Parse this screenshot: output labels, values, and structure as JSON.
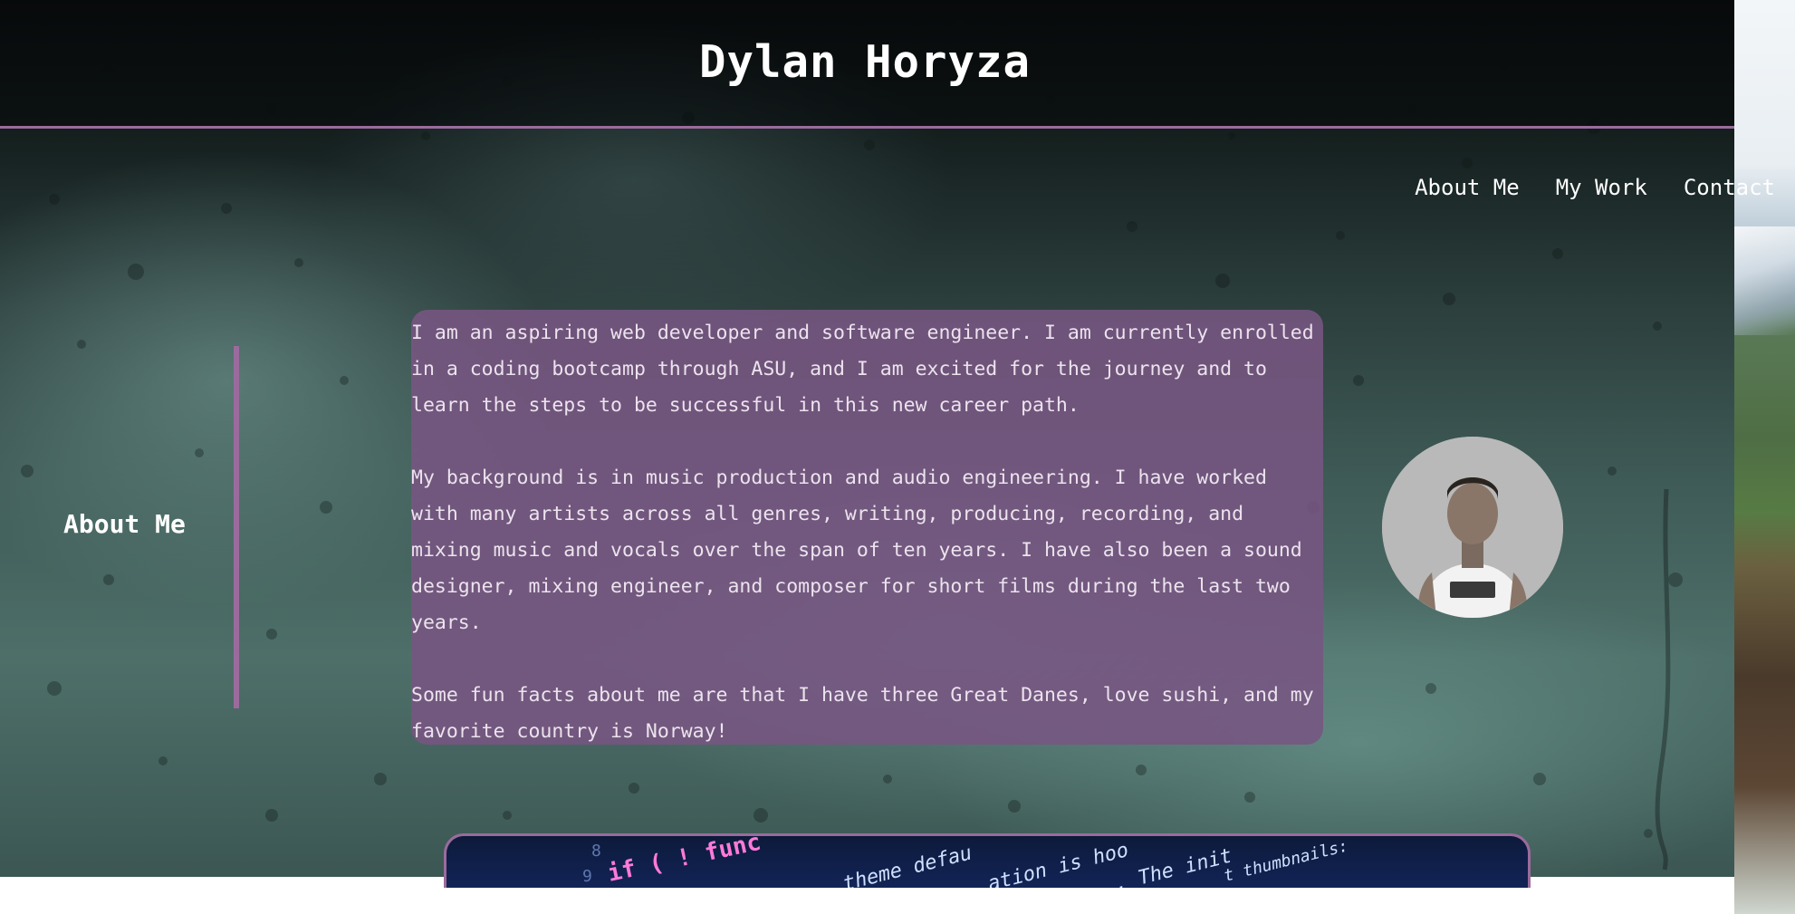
{
  "header": {
    "title": "Dylan Horyza"
  },
  "nav": {
    "items": [
      {
        "label": "About Me"
      },
      {
        "label": "My Work"
      },
      {
        "label": "Contact"
      }
    ]
  },
  "about": {
    "heading": "About Me",
    "paragraphs": [
      "I am an aspiring web developer and software engineer. I am currently enrolled in a coding bootcamp through ASU, and I am excited for the journey and to learn the steps to be successful in this new career path.",
      "My background is in music production and audio engineering. I have worked with many artists across all genres, writing, producing, recording, and mixing music and vocals over the span of ten years. I have also been a sound designer, mixing engineer, and composer for short films during the last two years.",
      "Some fun facts about me are that I have three Great Danes, love sushi, and my favorite country is Norway!"
    ]
  },
  "colors": {
    "accent": "#9b6b9d",
    "card": "#78558299"
  }
}
